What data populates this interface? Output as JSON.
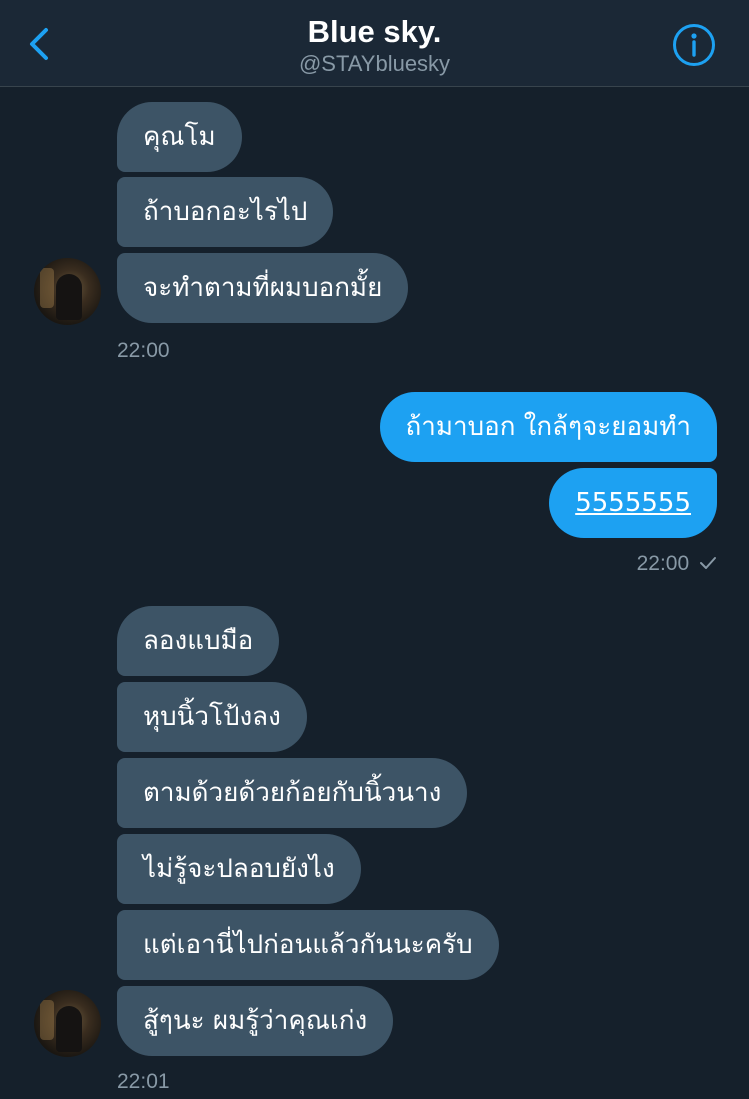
{
  "header": {
    "title": "Blue sky.",
    "handle": "@STAYbluesky",
    "back_icon": "chevron-left-icon",
    "info_icon": "info-icon",
    "accent_color": "#1da1f2"
  },
  "conversation": {
    "group1": {
      "messages": [
        "คุณโม",
        "ถ้าบอกอะไรไป",
        "จะทำตามที่ผมบอกมั้ย"
      ],
      "time": "22:00"
    },
    "group2": {
      "messages": [
        "ถ้ามาบอก ใกล้ๆจะยอมทำ",
        "5555555"
      ],
      "time": "22:00",
      "status_icon": "check-icon"
    },
    "group3": {
      "messages": [
        "ลองแบมือ",
        "หุบนิ้วโป้งลง",
        "ตามด้วยด้วยก้อยกับนิ้วนาง",
        "ไม่รู้จะปลอบยังไง",
        "แต่เอานี่ไปก่อนแล้วกันนะครับ",
        "สู้ๆนะ ผมรู้ว่าคุณเก่ง"
      ],
      "time": "22:01"
    }
  },
  "colors": {
    "background": "#15202b",
    "incoming_bubble": "#3d5466",
    "outgoing_bubble": "#1da1f2",
    "secondary_text": "#8899a6"
  }
}
